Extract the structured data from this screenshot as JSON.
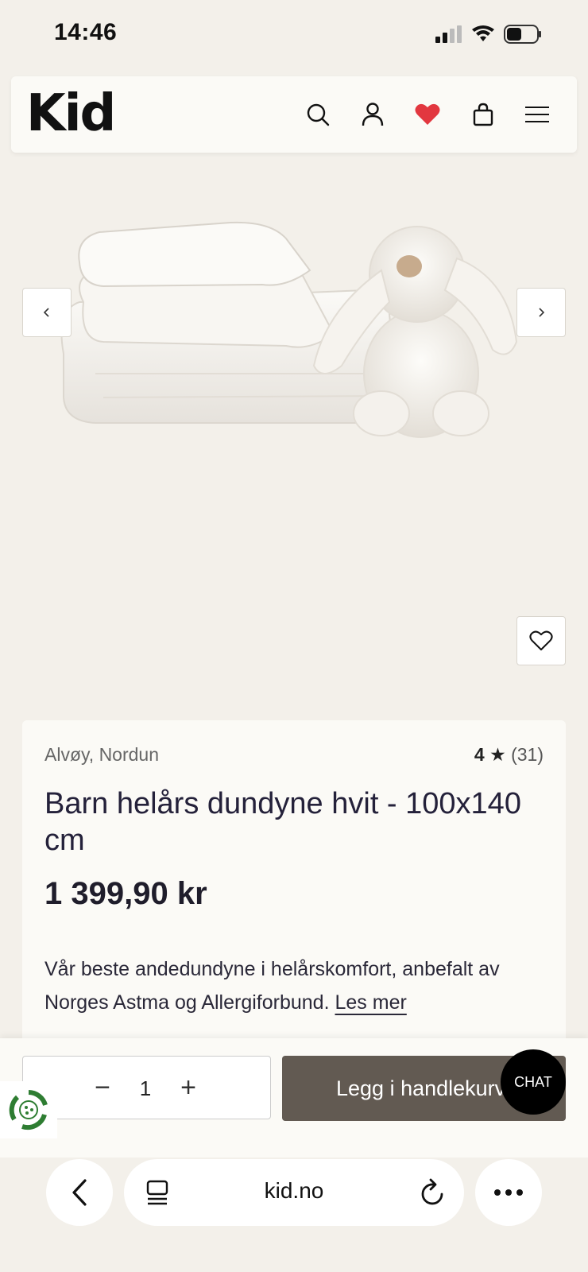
{
  "status": {
    "time": "14:46"
  },
  "header": {
    "logo": "Kid",
    "icons": [
      "search-icon",
      "user-icon",
      "heart-icon",
      "bag-icon",
      "menu-icon"
    ],
    "accent_heart": "#e2373f"
  },
  "gallery": {
    "prev": "prev-arrow-icon",
    "next": "next-arrow-icon"
  },
  "product": {
    "brand": "Alvøy, Nordun",
    "rating_value": "4",
    "rating_star": "★",
    "rating_count": "(31)",
    "title": "Barn helårs dundyne hvit - 100x140 cm",
    "price": "1 399,90 kr",
    "description": "Vår beste andedundyne i helårskomfort, anbefalt av Norges Astma og Allergiforbund.",
    "read_more": "Les mer"
  },
  "buy": {
    "minus": "−",
    "quantity": "1",
    "plus": "+",
    "add_to_cart": "Legg i handlekurv",
    "chat": "CHAT",
    "button_color": "#625a52"
  },
  "browser": {
    "url": "kid.no"
  }
}
